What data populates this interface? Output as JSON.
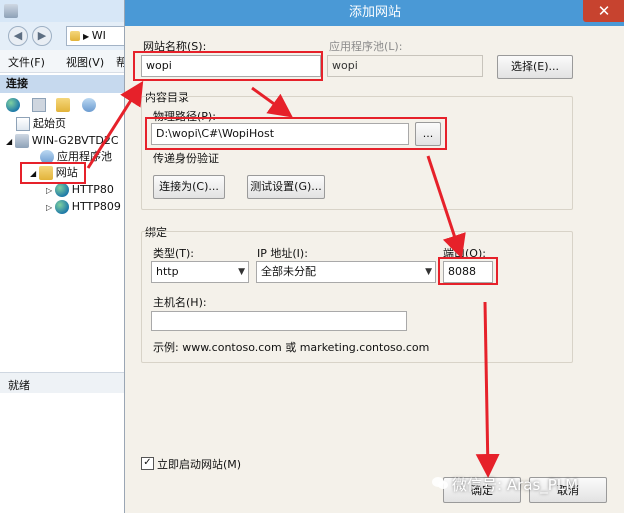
{
  "background_window": {
    "address_text": "WI",
    "menu": [
      "文件(F)",
      "视图(V)",
      "帮"
    ],
    "connections_title": "连接",
    "tree": [
      {
        "label": "起始页",
        "icon": "start-page-icon"
      },
      {
        "label": "WIN-G2BVTD2C",
        "icon": "server-icon"
      },
      {
        "label": "应用程序池",
        "icon": "app-pool-icon"
      },
      {
        "label": "网站",
        "icon": "sites-folder-icon"
      },
      {
        "label": "HTTP80",
        "icon": "globe-icon"
      },
      {
        "label": "HTTP809",
        "icon": "globe-icon"
      }
    ],
    "status": "就绪"
  },
  "dialog": {
    "title": "添加网站",
    "close": "✕",
    "site_name_label": "网站名称(S):",
    "site_name_value": "wopi",
    "app_pool_label": "应用程序池(L):",
    "app_pool_value": "wopi",
    "select_button": "选择(E)...",
    "content_dir_label": "内容目录",
    "physical_path_label": "物理路径(P):",
    "physical_path_value": "D:\\wopi\\C#\\WopiHost",
    "browse_button": "...",
    "pass_through_label": "传递身份验证",
    "connect_as_button": "连接为(C)...",
    "test_settings_button": "测试设置(G)...",
    "binding_label": "绑定",
    "type_label": "类型(T):",
    "type_value": "http",
    "ip_label": "IP 地址(I):",
    "ip_value": "全部未分配",
    "port_label": "端口(O):",
    "port_value": "8088",
    "host_label": "主机名(H):",
    "host_value": "",
    "example_text": "示例: www.contoso.com 或 marketing.contoso.com",
    "start_checkbox_label": "立即启动网站(M)",
    "start_checked": true,
    "ok_button": "确定",
    "cancel_button": "取消"
  },
  "watermark": "微信号: Aras_PLM",
  "colors": {
    "highlight": "#e6212a",
    "titlebar": "#4a99d6",
    "close": "#c7432f"
  }
}
